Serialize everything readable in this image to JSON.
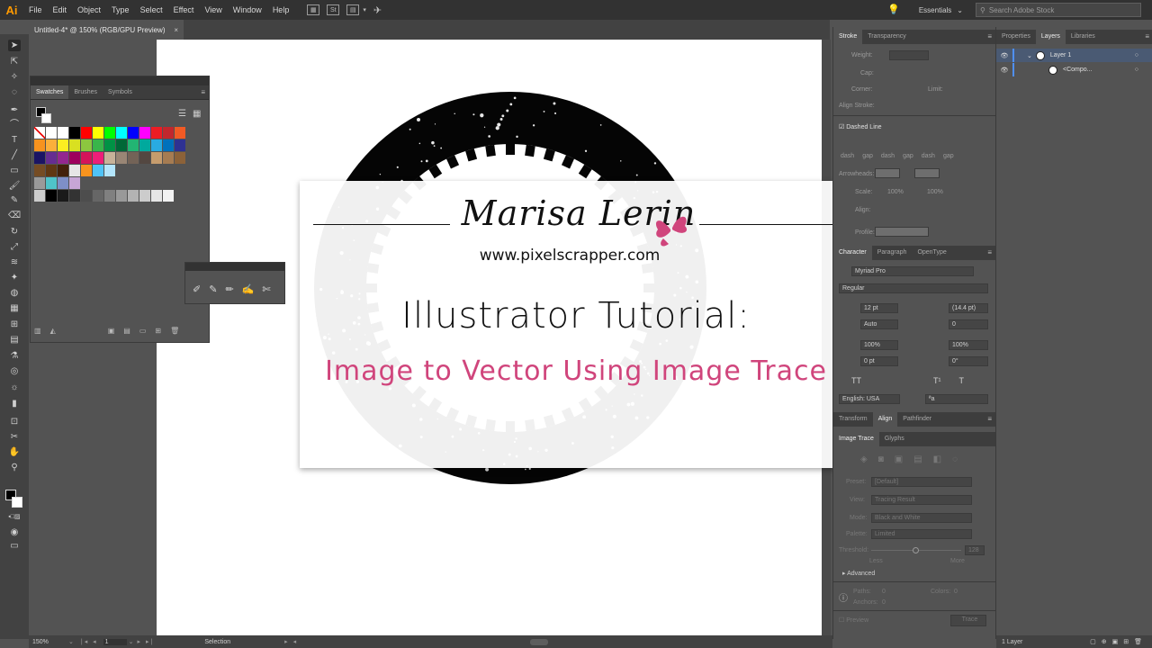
{
  "menubar": {
    "logo": "Ai",
    "items": [
      "File",
      "Edit",
      "Object",
      "Type",
      "Select",
      "Effect",
      "View",
      "Window",
      "Help"
    ],
    "st_icon": "St",
    "workspace": "Essentials",
    "search_placeholder": "Search Adobe Stock"
  },
  "document": {
    "tab_title": "Untitled-4* @ 150% (RGB/GPU Preview)",
    "close": "×"
  },
  "title_card": {
    "brand": "Marisa Lerin",
    "url": "www.pixelscrapper.com",
    "line1": "Illustrator Tutorial:",
    "line2": "Image to Vector Using Image Trace",
    "accent_color": "#d0457c"
  },
  "swatches_panel": {
    "tabs": [
      "Swatches",
      "Brushes",
      "Symbols"
    ],
    "rows": [
      [
        "none",
        "#ffffff",
        "#ffffff",
        "#000000",
        "#ff0000",
        "#ffff00",
        "#00ff00",
        "#00ffff",
        "#0000ff",
        "#ff00ff",
        "#ed1c24",
        "#c1272d",
        "#f15a24"
      ],
      [
        "#f7931e",
        "#fbb03b",
        "#fcee21",
        "#d9e021",
        "#8cc63f",
        "#39b54a",
        "#009245",
        "#006837",
        "#22b573",
        "#00a99d",
        "#29abe2",
        "#0071bc",
        "#2e3192"
      ],
      [
        "#1b1464",
        "#662d91",
        "#93278f",
        "#9e005d",
        "#d4145a",
        "#ed1e79",
        "#c7b299",
        "#998675",
        "#736357",
        "#534741",
        "#c69c6d",
        "#a67c52",
        "#8c6239"
      ],
      [
        "#754c24",
        "#603813",
        "#42210b",
        "#e6e6e6",
        "#f7931e",
        "#4fc3f7",
        "#b3e5fc",
        "#535353",
        "#535353",
        "#535353",
        "#535353",
        "#535353",
        "#535353"
      ],
      [
        "#9a9a9a",
        "#4fc3c9",
        "#7e8fc7",
        "#c7a5d6",
        "#535353",
        "#535353",
        "#535353",
        "#535353",
        "#535353",
        "#535353",
        "#535353",
        "#535353",
        "#535353"
      ],
      [
        "#cccccc",
        "#000000",
        "#1a1a1a",
        "#333333",
        "#4d4d4d",
        "#666666",
        "#808080",
        "#999999",
        "#b3b3b3",
        "#cccccc",
        "#e6e6e6",
        "#f2f2f2",
        "#535353"
      ]
    ]
  },
  "right_panel": {
    "stroke_tabs": [
      "Stroke",
      "Transparency"
    ],
    "weight_label": "Weight:",
    "cap_label": "Cap:",
    "corner_label": "Corner:",
    "limit_label": "Limit:",
    "align_stroke_label": "Align Stroke:",
    "dashed_line_label": "Dashed Line",
    "dash_labels": [
      "dash",
      "gap",
      "dash",
      "gap",
      "dash",
      "gap"
    ],
    "arrowheads_label": "Arrowheads:",
    "scale_label": "Scale:",
    "scale_value_1": "100%",
    "scale_value_2": "100%",
    "align_label": "Align:",
    "profile_label": "Profile:",
    "char_tabs": [
      "Character",
      "Paragraph",
      "OpenType"
    ],
    "font_family": "Myriad Pro",
    "font_style": "Regular",
    "font_size": "12 pt",
    "leading": "(14.4 pt)",
    "kerning": "Auto",
    "tracking": "0",
    "vscale": "100%",
    "hscale": "100%",
    "baseline": "0 pt",
    "rotation": "0°",
    "tt_label": "TT",
    "t1_label": "T¹",
    "t_label": "T",
    "language": "English: USA",
    "aa_label": "ªa",
    "align_tabs": [
      "Transform",
      "Align",
      "Pathfinder"
    ],
    "trace_tabs": [
      "Image Trace",
      "Glyphs"
    ],
    "preset_label": "Preset:",
    "preset_value": "[Default]",
    "view_label": "View:",
    "view_value": "Tracing Result",
    "mode_label": "Mode:",
    "mode_value": "Black and White",
    "palette_label": "Palette:",
    "palette_value": "Limited",
    "threshold_label": "Threshold:",
    "threshold_value": "128",
    "less_label": "Less",
    "more_label": "More",
    "advanced_label": "Advanced",
    "paths_label": "Paths:",
    "paths_value": "0",
    "colors_label": "Colors:",
    "colors_value": "0",
    "anchors_label": "Anchors:",
    "anchors_value": "0",
    "preview_label": "Preview",
    "trace_button": "Trace"
  },
  "layers_panel": {
    "tabs": [
      "Properties",
      "Layers",
      "Libraries"
    ],
    "layer_name": "Layer 1",
    "sublayer_name": "<Compo...",
    "footer": "1 Layer"
  },
  "statusbar": {
    "zoom": "150%",
    "page": "1",
    "tool": "Selection"
  },
  "icons": {
    "selection": "selection-tool-icon",
    "pen": "pen-tool-icon",
    "type": "type-tool-icon"
  }
}
